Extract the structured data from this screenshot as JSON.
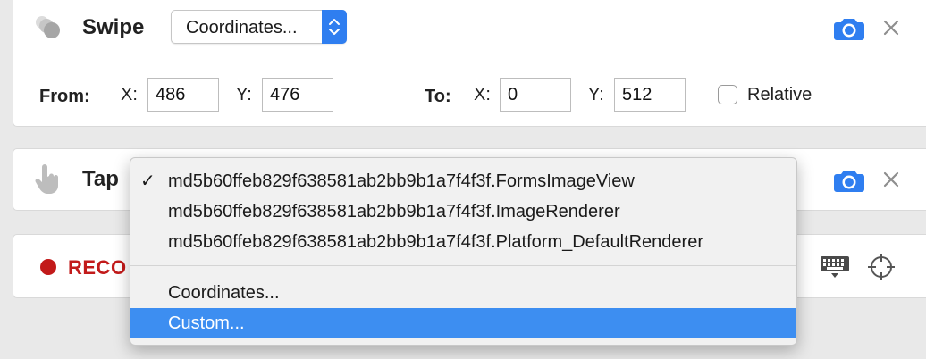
{
  "swipe": {
    "title": "Swipe",
    "selector_value": "Coordinates...",
    "from_label": "From:",
    "to_label": "To:",
    "x_label": "X:",
    "y_label": "Y:",
    "from_x": "486",
    "from_y": "476",
    "to_x": "0",
    "to_y": "512",
    "relative_label": "Relative",
    "relative_checked": false
  },
  "tap": {
    "title": "Tap"
  },
  "record": {
    "label": "RECO"
  },
  "dropdown_menu": {
    "items": [
      {
        "label": "md5b60ffeb829f638581ab2bb9b1a7f4f3f.FormsImageView",
        "checked": true
      },
      {
        "label": "md5b60ffeb829f638581ab2bb9b1a7f4f3f.ImageRenderer",
        "checked": false
      },
      {
        "label": "md5b60ffeb829f638581ab2bb9b1a7f4f3f.Platform_DefaultRenderer",
        "checked": false
      }
    ],
    "extra_items": [
      {
        "label": "Coordinates..."
      },
      {
        "label": "Custom...",
        "highlighted": true
      }
    ],
    "check_glyph": "✓"
  },
  "colors": {
    "accent": "#2f7ef0",
    "highlight": "#3d8ef1",
    "record_red": "#c21a1a"
  },
  "icons": {
    "swipe": "swipe-gesture-icon",
    "tap": "tap-hand-icon",
    "camera": "camera-icon",
    "close": "close-icon",
    "record": "record-dot-icon",
    "keyboard": "keyboard-icon",
    "crosshair": "crosshair-icon"
  }
}
